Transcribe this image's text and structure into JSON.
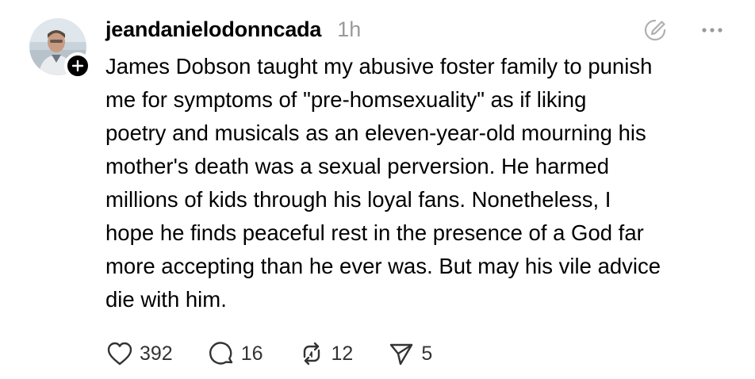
{
  "post": {
    "author": {
      "username": "jeandanielodonncada",
      "avatar_icon": "profile-photo",
      "follow_icon": "plus-icon"
    },
    "timestamp": "1h",
    "top_icons": [
      "edit-circle-icon",
      "more-icon"
    ],
    "text": "James Dobson taught my abusive foster family to punish\nme for symptoms of \"pre-homsexuality\" as if liking\npoetry and musicals as an eleven-year-old mourning his\nmother's death was a sexual perversion. He harmed\nmillions of kids through his loyal fans. Nonetheless, I\nhope he finds peaceful rest in the presence of a God far\nmore accepting than he ever was. But may his vile advice\ndie with him.",
    "actions": {
      "likes": "392",
      "replies": "16",
      "reposts": "12",
      "shares": "5"
    }
  },
  "colors": {
    "text": "#000000",
    "muted": "#9a9a9a",
    "icon": "#333333",
    "background": "#ffffff"
  }
}
